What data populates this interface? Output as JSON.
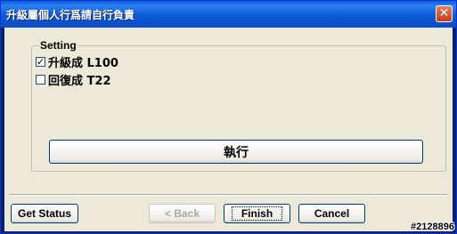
{
  "window": {
    "title": "升級屬個人行爲請自行負責",
    "close_label": "✕"
  },
  "group": {
    "legend": "Setting",
    "options": [
      {
        "label": "升級成 L100",
        "checked": true,
        "mark": "✓"
      },
      {
        "label": "回復成 T22",
        "checked": false,
        "mark": ""
      }
    ],
    "execute_label": "執行"
  },
  "footer": {
    "get_status_label": "Get Status",
    "back_label": "< Back",
    "finish_label": "Finish",
    "cancel_label": "Cancel"
  },
  "watermark": "#2128896",
  "colors": {
    "title_bar": "#0a5fd8",
    "dialog_bg": "#ece9d8",
    "close_button": "#c6391b"
  }
}
